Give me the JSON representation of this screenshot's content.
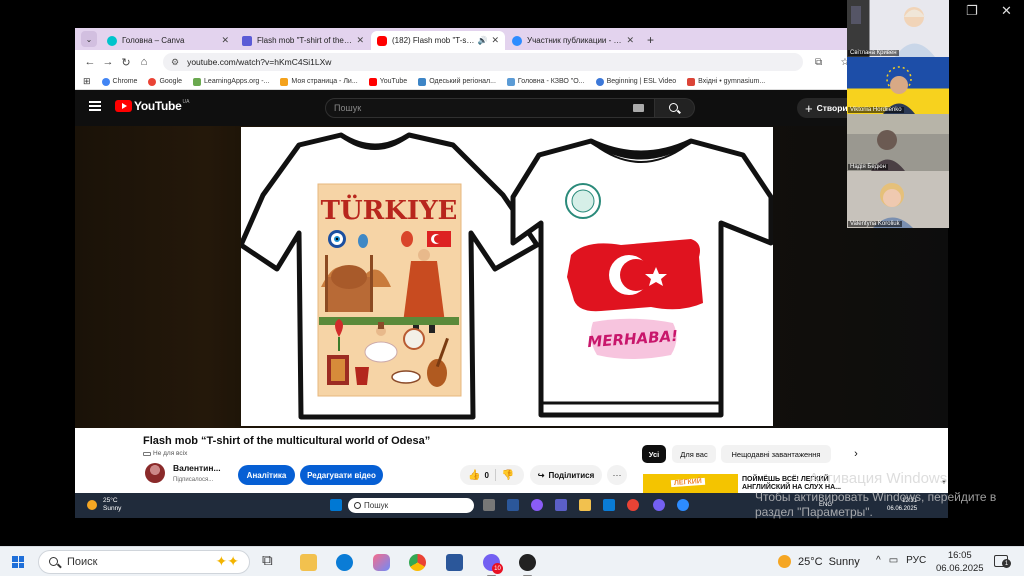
{
  "outer_window": {
    "minimize": "—",
    "restore": "❐",
    "close": "✕"
  },
  "browser": {
    "tabs": [
      {
        "label": "Головна – Canva",
        "icon_color": "#00c4cc",
        "close": "✕"
      },
      {
        "label": "Flash mob \"T-shirt of the multic",
        "icon_color": "#5b5bd6",
        "close": "✕"
      },
      {
        "label": "(182) Flash mob \"T-shirt of",
        "icon_color": "#ff0000",
        "close": "✕",
        "active": true
      },
      {
        "label": "Участник публикации - Zoom",
        "icon_color": "#2d8cff",
        "close": "✕"
      }
    ],
    "new_tab": "+",
    "tab_down": "⌄",
    "url": "youtube.com/watch?v=hKmC4Si1LXw",
    "nav": {
      "back": "←",
      "forward": "→",
      "reload": "↻",
      "home": "⌂"
    },
    "toolbar_right": "⧉ ☆ ⋮",
    "bookmarks": [
      {
        "label": "Chrome",
        "color": "#4285f4"
      },
      {
        "label": "Google",
        "color": "#ea4335"
      },
      {
        "label": "LearningApps.org -...",
        "color": "#6aa84f"
      },
      {
        "label": "Моя страница - Ли...",
        "color": "#f4a21c"
      },
      {
        "label": "YouTube",
        "color": "#ff0000"
      },
      {
        "label": "Одеський регіонал...",
        "color": "#3d85c6"
      },
      {
        "label": "Головна - КЗВО \"О...",
        "color": "#5b9bd5"
      },
      {
        "label": "Beginning | ESL Video",
        "color": "#3c78d8"
      },
      {
        "label": "Вхідні • gymnasium...",
        "color": "#db4437"
      }
    ]
  },
  "youtube": {
    "logo_text": "YouTube",
    "region": "UA",
    "search_placeholder": "Пошук",
    "create_label": "Створи",
    "video": {
      "title": "Flash mob “T-shirt of the multicultural world of Odesa”",
      "visibility": "Не для всіх",
      "channel_name": "Валентин...",
      "channel_subs": "Підписалося...",
      "analytics_button": "Аналітика",
      "edit_button": "Редагувати відео",
      "likes": "0",
      "share_button": "Поділитися",
      "more": "···"
    },
    "shirt_left_text": "TÜRKIYE",
    "shirt_right_text": "MERHABA!",
    "chips": [
      "Усі",
      "Для вас",
      "Нещодавні завантаження"
    ],
    "chip_next": "›",
    "recommendation": {
      "title": "ПОЙМЁШЬ ВСЁ! ЛЕГКИЙ АНГЛИЙСКИЙ НА СЛУХ НА...",
      "thumb_tag": "ЛЕГКИЙ"
    }
  },
  "remote_taskbar": {
    "weather_temp": "25°C",
    "weather_desc": "Sunny",
    "search_placeholder": "Пошук",
    "tray_lang": "ENG",
    "time": "12:31",
    "date": "06.06.2025"
  },
  "watermark": {
    "line1_big": "Активация Windows",
    "line2": "Чтобы активировать Windows, перейдите в",
    "line3": "раздел \"Параметры\"."
  },
  "zoom_participants": [
    {
      "name": "Світлана Кривен"
    },
    {
      "name": "Viktoriia Hordiienko"
    },
    {
      "name": "Надія Бедюн"
    },
    {
      "name": "Valentyna Koroliuk"
    }
  ],
  "windows_taskbar": {
    "search_placeholder": "Поиск",
    "weather_temp": "25°C",
    "weather_desc": "Sunny",
    "lang": "РУС",
    "time": "16:05",
    "date": "06.06.2025",
    "notification_count": "1",
    "viber_badge": "10"
  }
}
